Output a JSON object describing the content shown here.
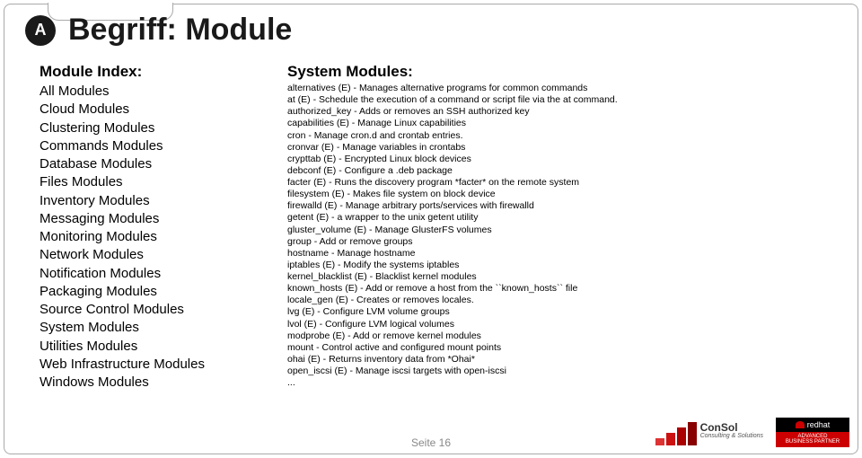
{
  "header": {
    "logo_glyph": "A",
    "title": "Begriff: Module"
  },
  "module_index": {
    "title": "Module Index:",
    "items": [
      "All Modules",
      "Cloud Modules",
      "Clustering Modules",
      "Commands Modules",
      "Database Modules",
      "Files Modules",
      "Inventory Modules",
      "Messaging Modules",
      "Monitoring Modules",
      "Network Modules",
      "Notification Modules",
      "Packaging Modules",
      "Source Control Modules",
      "System Modules",
      "Utilities Modules",
      "Web Infrastructure Modules",
      "Windows Modules"
    ]
  },
  "system_modules": {
    "title": "System Modules:",
    "items": [
      "alternatives (E) - Manages alternative programs for common commands",
      "at (E) - Schedule the execution of a command or script file via the at command.",
      "authorized_key - Adds or removes an SSH authorized key",
      "capabilities (E) - Manage Linux capabilities",
      "cron - Manage cron.d and crontab entries.",
      "cronvar (E) - Manage variables in crontabs",
      "crypttab (E) - Encrypted Linux block devices",
      "debconf (E) - Configure a .deb package",
      "facter (E) - Runs the discovery program *facter* on the remote system",
      "filesystem (E) - Makes file system on block device",
      "firewalld (E) - Manage arbitrary ports/services with firewalld",
      "getent (E) - a wrapper to the unix getent utility",
      "gluster_volume (E) - Manage GlusterFS volumes",
      "group - Add or remove groups",
      "hostname - Manage hostname",
      "iptables (E) - Modify the systems iptables",
      "kernel_blacklist (E) - Blacklist kernel modules",
      "known_hosts (E) - Add or remove a host from the ``known_hosts`` file",
      "locale_gen (E) - Creates or removes locales.",
      "lvg (E) - Configure LVM volume groups",
      "lvol (E) - Configure LVM logical volumes",
      "modprobe (E) - Add or remove kernel modules",
      "mount - Control active and configured mount points",
      "ohai (E) - Returns inventory data from *Ohai*",
      "open_iscsi (E) - Manage iscsi targets with open-iscsi",
      "..."
    ]
  },
  "footer": {
    "page_label": "Seite 16"
  },
  "branding": {
    "consol_name": "ConSol",
    "consol_tag": "Consulting & Solutions",
    "redhat_name": "redhat",
    "redhat_line1": "ADVANCED",
    "redhat_line2": "BUSINESS PARTNER"
  }
}
